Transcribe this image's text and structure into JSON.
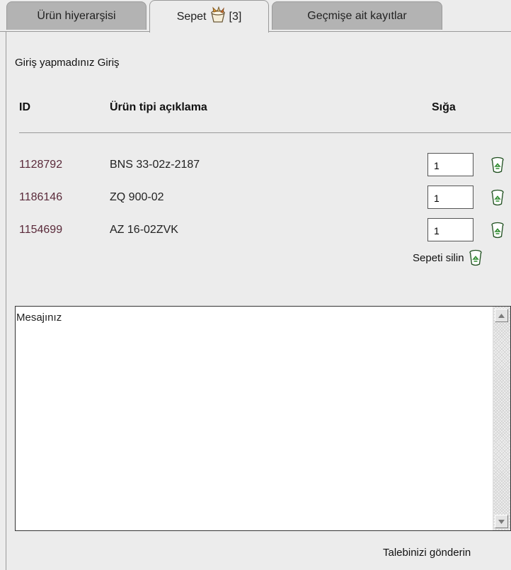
{
  "tabs": [
    {
      "label": "Ürün hiyerarşisi",
      "active": false
    },
    {
      "label": "Sepet",
      "count": "[3]",
      "active": true
    },
    {
      "label": "Geçmişe ait kayıtlar",
      "active": false
    }
  ],
  "login": {
    "status": "Giriş yapmadınız",
    "link": "Giriş"
  },
  "table": {
    "headers": {
      "id": "ID",
      "description": "Ürün tipi açıklama",
      "quantity": "Sığa"
    },
    "rows": [
      {
        "id": "1128792",
        "description": "BNS 33-02z-2187",
        "quantity": "1"
      },
      {
        "id": "1186146",
        "description": "ZQ 900-02",
        "quantity": "1"
      },
      {
        "id": "1154699",
        "description": "AZ 16-02ZVK",
        "quantity": "1"
      }
    ]
  },
  "clear_basket": {
    "label": "Sepeti silin"
  },
  "message": {
    "label": "Mesajınız"
  },
  "submit": {
    "label": "Talebinizi gönderin"
  },
  "icons": {
    "basket": "basket-icon",
    "delete": "trash-bin-icon"
  },
  "colors": {
    "background": "#ececec",
    "inactive_tab": "#b3b3b3",
    "id_text": "#5a2a3a",
    "recycle_green": "#2e8b2e"
  }
}
